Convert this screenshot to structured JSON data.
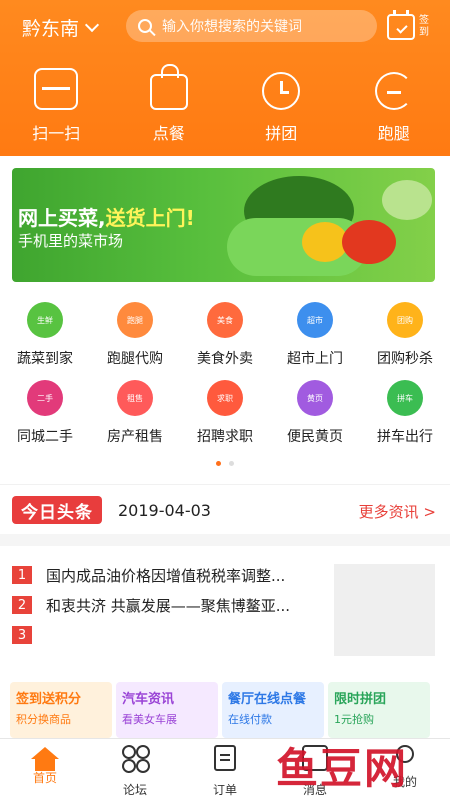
{
  "header": {
    "city": "黔东南",
    "search_placeholder": "输入你想搜索的关键词",
    "signin_label": "签到"
  },
  "quick_actions": [
    {
      "label": "扫一扫",
      "icon": "scan-icon"
    },
    {
      "label": "点餐",
      "icon": "shopping-bag-icon"
    },
    {
      "label": "拼团",
      "icon": "alarm-clock-icon"
    },
    {
      "label": "跑腿",
      "icon": "errand-icon"
    }
  ],
  "banner": {
    "title_part1": "网上买菜,",
    "title_part2": "送货上门!",
    "subtitle": "手机里的菜市场"
  },
  "categories": [
    {
      "label": "蔬菜到家",
      "badge": "生鲜",
      "color": "#58c341"
    },
    {
      "label": "跑腿代购",
      "badge": "跑腿",
      "color": "#ff8a3d"
    },
    {
      "label": "美食外卖",
      "badge": "美食",
      "color": "#ff6a3d"
    },
    {
      "label": "超市上门",
      "badge": "超市",
      "color": "#3d8fee"
    },
    {
      "label": "团购秒杀",
      "badge": "团购",
      "color": "#ffb31a"
    },
    {
      "label": "同城二手",
      "badge": "二手",
      "color": "#e23a7a"
    },
    {
      "label": "房产租售",
      "badge": "租售",
      "color": "#ff5a5a"
    },
    {
      "label": "招聘求职",
      "badge": "求职",
      "color": "#ff5a3d"
    },
    {
      "label": "便民黄页",
      "badge": "黄页",
      "color": "#a15be0"
    },
    {
      "label": "拼车出行",
      "badge": "拼车",
      "color": "#3bbd52"
    }
  ],
  "headlines": {
    "logo": "今日头条",
    "date": "2019-04-03",
    "more": "更多资讯 >",
    "items": [
      {
        "num": "1",
        "text": "国内成品油价格因增值税税率调整..."
      },
      {
        "num": "2",
        "text": "和衷共济 共赢发展——聚焦博鳌亚..."
      },
      {
        "num": "3",
        "text": ""
      }
    ]
  },
  "promos": [
    {
      "title": "签到送积分",
      "subtitle": "积分换商品"
    },
    {
      "title": "汽车资讯",
      "subtitle": "看美女车展"
    },
    {
      "title": "餐厅在线点餐",
      "subtitle": "在线付款"
    },
    {
      "title": "限时拼团",
      "subtitle": "1元抢购"
    }
  ],
  "tabs": [
    {
      "label": "首页",
      "icon": "home-icon",
      "active": true
    },
    {
      "label": "论坛",
      "icon": "forum-icon",
      "active": false
    },
    {
      "label": "订单",
      "icon": "order-icon",
      "active": false
    },
    {
      "label": "消息",
      "icon": "message-icon",
      "active": false
    },
    {
      "label": "我的",
      "icon": "profile-icon",
      "active": false
    }
  ],
  "watermark": "鱼豆网",
  "colors": {
    "brand_orange": "#ff7a12",
    "headline_red": "#e8403a"
  }
}
